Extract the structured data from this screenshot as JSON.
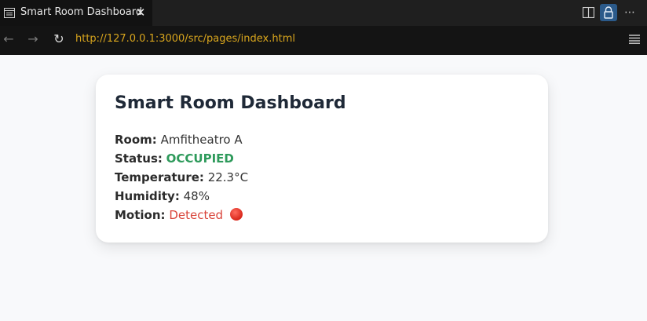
{
  "browser": {
    "tab_title": "Smart Room Dashboard",
    "url": "http://127.0.0.1:3000/src/pages/index.html",
    "accent_lock_bg": "#2b5a8a",
    "url_color": "#d8a51d"
  },
  "dashboard": {
    "title": "Smart Room Dashboard",
    "room_label": "Room:",
    "room_value": "Amfitheatro A",
    "status_label": "Status:",
    "status_value": "OCCUPIED",
    "status_color": "#2e9a5b",
    "temperature_label": "Temperature:",
    "temperature_value": "22.3°C",
    "humidity_label": "Humidity:",
    "humidity_value": "48%",
    "motion_label": "Motion:",
    "motion_value": "Detected",
    "motion_color": "#d9443a",
    "motion_icon": "red-circle-icon"
  }
}
